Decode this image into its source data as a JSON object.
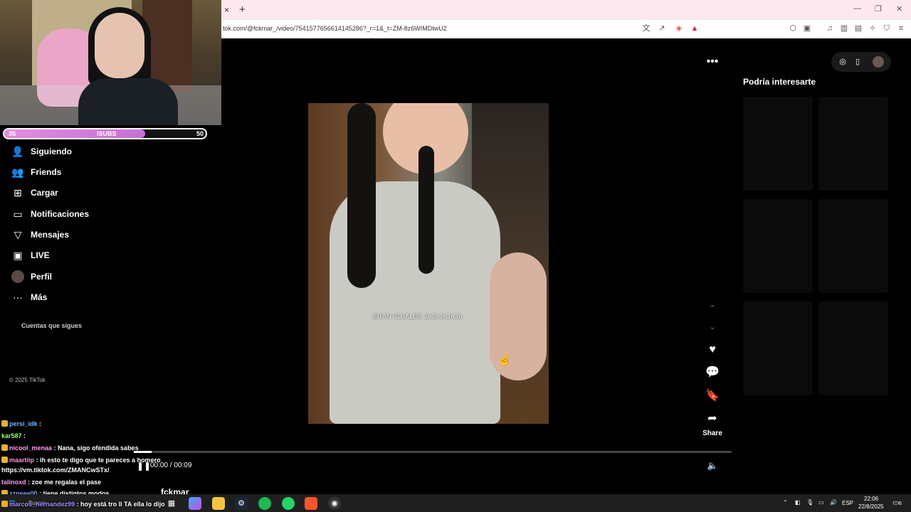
{
  "browser": {
    "tab_close": "×",
    "tab_new": "+",
    "url": "tok.com/@fckmar_/video/7541577656614145286?_r=1&_t=ZM-8z6WIMDtwU2"
  },
  "webcam_overlay": {
    "sub_goal": {
      "left": "35",
      "center": "ISUBS",
      "right": "50",
      "progress": 0.7
    }
  },
  "sidebar": {
    "items": [
      {
        "label": "Siguiendo",
        "icon": "user-follow-icon"
      },
      {
        "label": "Friends",
        "icon": "friends-icon"
      },
      {
        "label": "Cargar",
        "icon": "upload-icon"
      },
      {
        "label": "Notificaciones",
        "icon": "inbox-icon"
      },
      {
        "label": "Mensajes",
        "icon": "send-icon"
      },
      {
        "label": "LIVE",
        "icon": "live-icon"
      },
      {
        "label": "Perfil",
        "icon": "avatar"
      },
      {
        "label": "Más",
        "icon": "more-icon"
      }
    ],
    "following_header": "Cuentas que sigues",
    "copyright": "© 2025 TikTok"
  },
  "video": {
    "caption": "ERAN IGUALES JAJAJAJAJA",
    "time": "00:00 / 00:09",
    "progress": 0.03,
    "author": "fckmar"
  },
  "actions": {
    "share_label": "Share"
  },
  "recommendations": {
    "title": "Podría interesarte"
  },
  "chat": [
    {
      "user": "persi_idk",
      "color": "#6fb7ff",
      "text": ":"
    },
    {
      "user": "kar587",
      "color": "#9cff6f",
      "text": ":"
    },
    {
      "user": "nicool_menaa",
      "color": "#ff9cf0",
      "text": ": Nana, sigo ofendida sabes"
    },
    {
      "user": "maartiip",
      "color": "#ff8fd8",
      "text": ": ih esto te digo que te pareces a homero"
    },
    {
      "user": "",
      "color": "#fff",
      "text": "https://vm.tiktok.com/ZMANCwSTx/"
    },
    {
      "user": "talinoxd",
      "color": "#ff9cf0",
      "text": ": zoe me regalas el pase"
    },
    {
      "user": "zzpeee00",
      "color": "#7fa7ff",
      "text": ": tiene distintos modos"
    },
    {
      "user": "marcos_hernandez99",
      "color": "#a08bff",
      "text": ": hoy está tro ll TA ella lo dijo"
    }
  ],
  "taskbar": {
    "search": "Buscar",
    "lang": "ESP",
    "clock_time": "22:06",
    "clock_date": "22/8/2025",
    "notif_count": "6"
  }
}
